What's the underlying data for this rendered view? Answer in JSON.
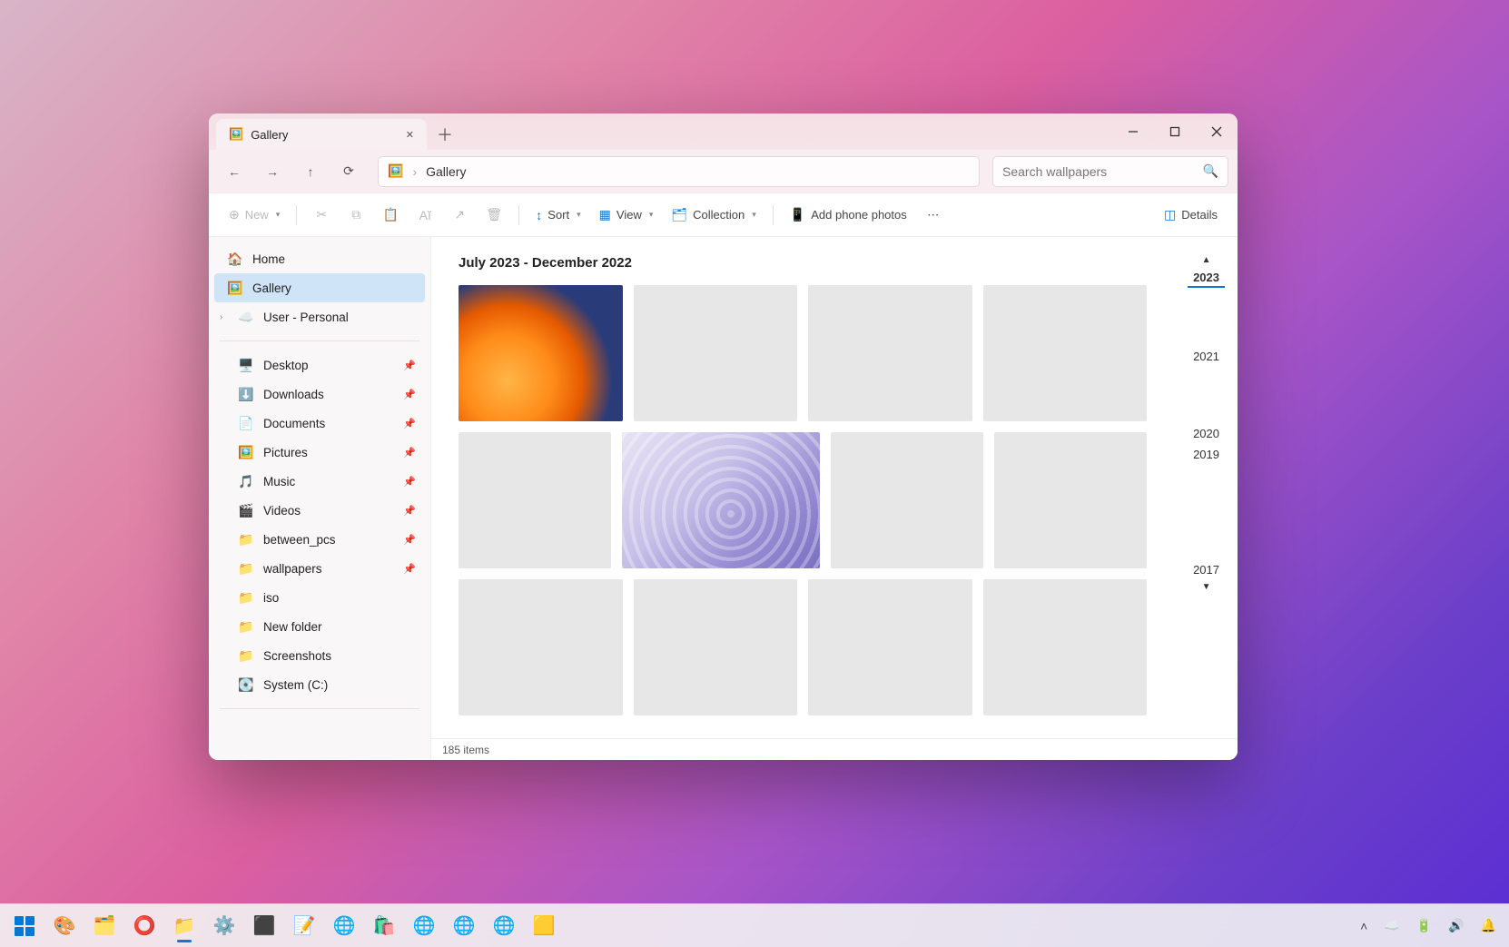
{
  "tab": {
    "title": "Gallery"
  },
  "breadcrumb": {
    "label": "Gallery"
  },
  "search": {
    "placeholder": "Search wallpapers"
  },
  "toolbar": {
    "new": "New",
    "sort": "Sort",
    "view": "View",
    "collection": "Collection",
    "add_phone": "Add phone photos",
    "details": "Details"
  },
  "sidebar": {
    "home": "Home",
    "gallery": "Gallery",
    "user": "User - Personal",
    "pinned": [
      {
        "label": "Desktop",
        "pin": true
      },
      {
        "label": "Downloads",
        "pin": true
      },
      {
        "label": "Documents",
        "pin": true
      },
      {
        "label": "Pictures",
        "pin": true
      },
      {
        "label": "Music",
        "pin": true
      },
      {
        "label": "Videos",
        "pin": true
      },
      {
        "label": "between_pcs",
        "pin": true
      },
      {
        "label": "wallpapers",
        "pin": true
      },
      {
        "label": "iso",
        "pin": false
      },
      {
        "label": "New folder",
        "pin": false
      },
      {
        "label": "Screenshots",
        "pin": false
      },
      {
        "label": "System (C:)",
        "pin": false
      }
    ]
  },
  "gallery": {
    "range": "July 2023 - December 2022",
    "timeline": [
      "2023",
      "2021",
      "2020",
      "2019",
      "2017"
    ]
  },
  "status": {
    "count": "185 items"
  }
}
